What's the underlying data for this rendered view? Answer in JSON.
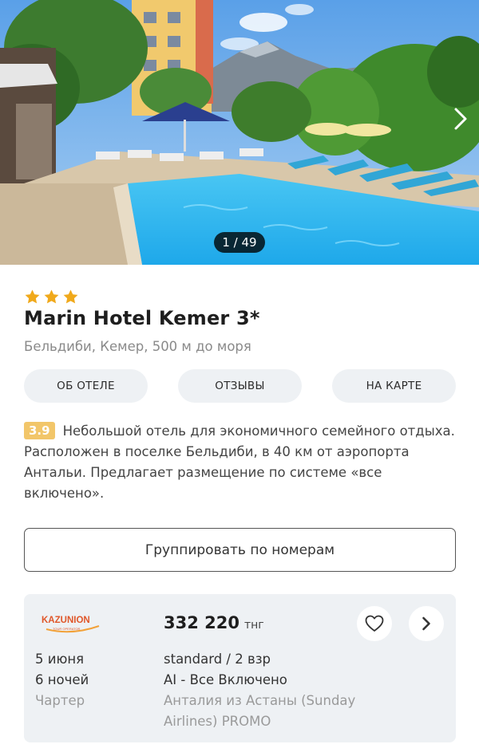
{
  "gallery": {
    "counter": "1 / 49",
    "next_icon": "chevron-right-icon"
  },
  "hotel": {
    "stars": 3,
    "name": "Marin Hotel Kemer 3*",
    "location": "Бельдиби, Кемер, 500 м до моря"
  },
  "tabs": [
    {
      "label": "ОБ ОТЕЛЕ"
    },
    {
      "label": "ОТЗЫВЫ"
    },
    {
      "label": "НА КАРТЕ"
    }
  ],
  "description": {
    "rating": "3.9",
    "rating_color": "#f2c66a",
    "text": "Небольшой отель для экономичного семейного отдыха. Расположен в поселке Бельдиби, в 40 км от аэропорта Антальи. Предлагает размещение по системе «все включено»."
  },
  "group_button": {
    "label": "Группировать по номерам"
  },
  "offer": {
    "operator_logo": "KAZUNION",
    "operator_logo_sub": "TOUR OPERATOR",
    "price": "332 220",
    "currency": "тнг",
    "date": "5 июня",
    "nights": "6 ночей",
    "flight_type": "Чартер",
    "room": "standard / 2 взр",
    "meal": "AI - Все Включено",
    "flight": "Анталия из Астаны (Sunday Airlines) PROMO",
    "favorite_icon": "heart-icon",
    "open_icon": "chevron-right-icon"
  }
}
